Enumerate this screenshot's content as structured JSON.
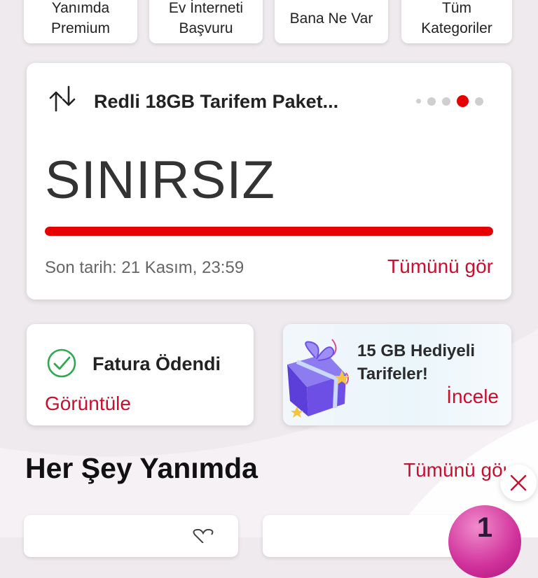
{
  "quick_actions": [
    {
      "label": "Yanımda\nPremium"
    },
    {
      "label": "Ev İnterneti\nBaşvuru"
    },
    {
      "label": "Bana Ne Var"
    },
    {
      "label": "Tüm\nKategoriler"
    }
  ],
  "usage_card": {
    "title": "Redli 18GB Tarifem Paket...",
    "amount": "SINIRSIZ",
    "progress_fraction": 1.0,
    "deadline": "Son tarih: 21 Kasım, 23:59",
    "link": "Tümünü gör",
    "pager_total": 5,
    "pager_active_index": 3
  },
  "bill_card": {
    "title": "Fatura Ödendi",
    "link": "Görüntüle"
  },
  "promo_card": {
    "text": "15 GB Hediyeli\nTarifeler!",
    "link": "İncele"
  },
  "section": {
    "title": "Her Şey Yanımda",
    "link": "Tümünü gör"
  },
  "badge": {
    "count": "1"
  },
  "colors": {
    "brand_red": "#e60000",
    "link_red": "#c8102e",
    "success_green": "#2fa84f",
    "background": "#efeaee"
  },
  "icons": {
    "usage": "swap-arrows-icon",
    "bill": "check-circle-icon",
    "promo": "gift-box-icon",
    "favorite": "heart-icon",
    "close": "close-icon"
  }
}
